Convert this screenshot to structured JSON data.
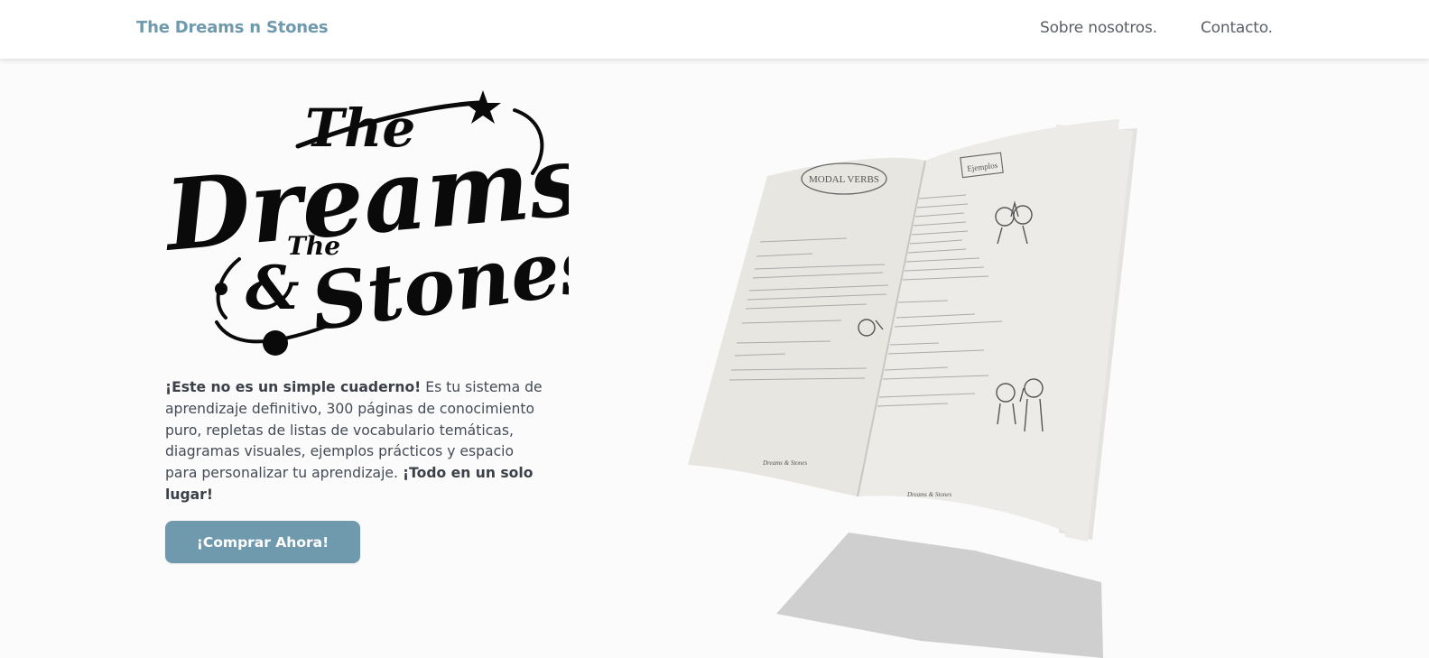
{
  "navbar": {
    "brand": "The Dreams n Stones",
    "links": [
      {
        "label": "Sobre nosotros."
      },
      {
        "label": "Contacto."
      }
    ]
  },
  "logo": {
    "line1": "The",
    "line2": "Dreams",
    "line3": "&",
    "line4": "The",
    "line5": "Stones"
  },
  "hero": {
    "lead_bold": "¡Este no es un simple cuaderno!",
    "body": " Es tu sistema de aprendizaje definitivo, 300 páginas de conocimiento puro, repletas de listas de vocabulario temáticas, diagramas visuales, ejemplos prácticos y espacio para personalizar tu aprendizaje. ",
    "tail_bold": "¡Todo en un solo lugar!",
    "cta_label": "¡Comprar Ahora!"
  },
  "book": {
    "left_heading": "MODAL VERBS",
    "right_heading": "Ejemplos",
    "left_footer_logo": "Dreams & Stones",
    "right_footer_logo": "Dreams & Stones"
  },
  "colors": {
    "accent": "#6f9aad",
    "nav_text": "#5a5f66",
    "body_text": "#454b55"
  }
}
